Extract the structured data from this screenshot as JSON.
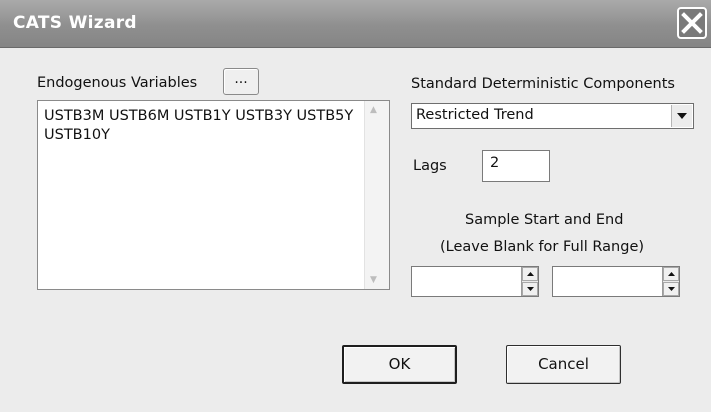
{
  "window": {
    "title": "CATS Wizard",
    "close_icon": "close-icon"
  },
  "endogenous": {
    "label": "Endogenous Variables",
    "browse_label": "...",
    "variables_text": "USTB3M USTB6M USTB1Y USTB3Y USTB5Y USTB10Y"
  },
  "deterministic": {
    "label": "Standard Deterministic Components",
    "selected": "Restricted Trend"
  },
  "lags": {
    "label": "Lags",
    "value": "2"
  },
  "sample": {
    "label_line1": "Sample Start and End",
    "label_line2": "(Leave Blank for Full Range)",
    "start_value": "",
    "end_value": ""
  },
  "buttons": {
    "ok_label": "OK",
    "cancel_label": "Cancel"
  }
}
